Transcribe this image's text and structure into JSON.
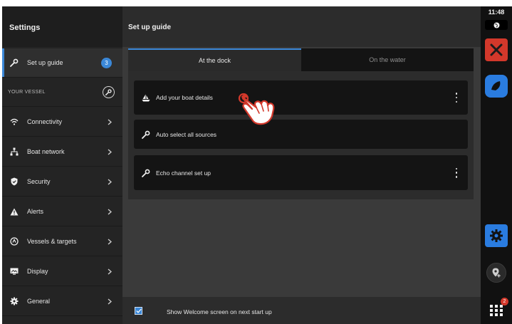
{
  "sidebar": {
    "title": "Settings",
    "setup_item": {
      "label": "Set up guide",
      "badge": "3",
      "icon": "wrench-icon"
    },
    "section_label": "YOUR VESSEL",
    "items": [
      {
        "label": "Connectivity",
        "icon": "wifi-icon"
      },
      {
        "label": "Boat network",
        "icon": "network-icon"
      },
      {
        "label": "Security",
        "icon": "shield-icon"
      },
      {
        "label": "Alerts",
        "icon": "alert-icon"
      },
      {
        "label": "Vessels & targets",
        "icon": "target-icon"
      },
      {
        "label": "Display",
        "icon": "display-icon"
      },
      {
        "label": "General",
        "icon": "gear-icon"
      }
    ]
  },
  "main": {
    "title": "Set up guide",
    "tabs": [
      {
        "label": "At the dock",
        "active": true
      },
      {
        "label": "On the water",
        "active": false
      }
    ],
    "cards": [
      {
        "label": "Add your boat details",
        "icon": "boat-icon",
        "has_menu": true
      },
      {
        "label": "Auto select all sources",
        "icon": "wrench-icon",
        "has_menu": false
      },
      {
        "label": "Echo channel set up",
        "icon": "wrench-icon",
        "has_menu": true
      }
    ],
    "footer": {
      "checkbox_label": "Show Welcome screen on next start up",
      "checked": true
    }
  },
  "rightbar": {
    "time": "11:48",
    "notification_count": "2",
    "apps": [
      {
        "name": "mob-app",
        "color": "#d3382b"
      },
      {
        "name": "chart-app",
        "color": "#2a7ce0"
      },
      {
        "name": "settings-app",
        "color": "#2a7ce0"
      }
    ]
  },
  "colors": {
    "accent": "#3b88d8",
    "background": "#1b1b1b",
    "alert": "#d3382b"
  }
}
